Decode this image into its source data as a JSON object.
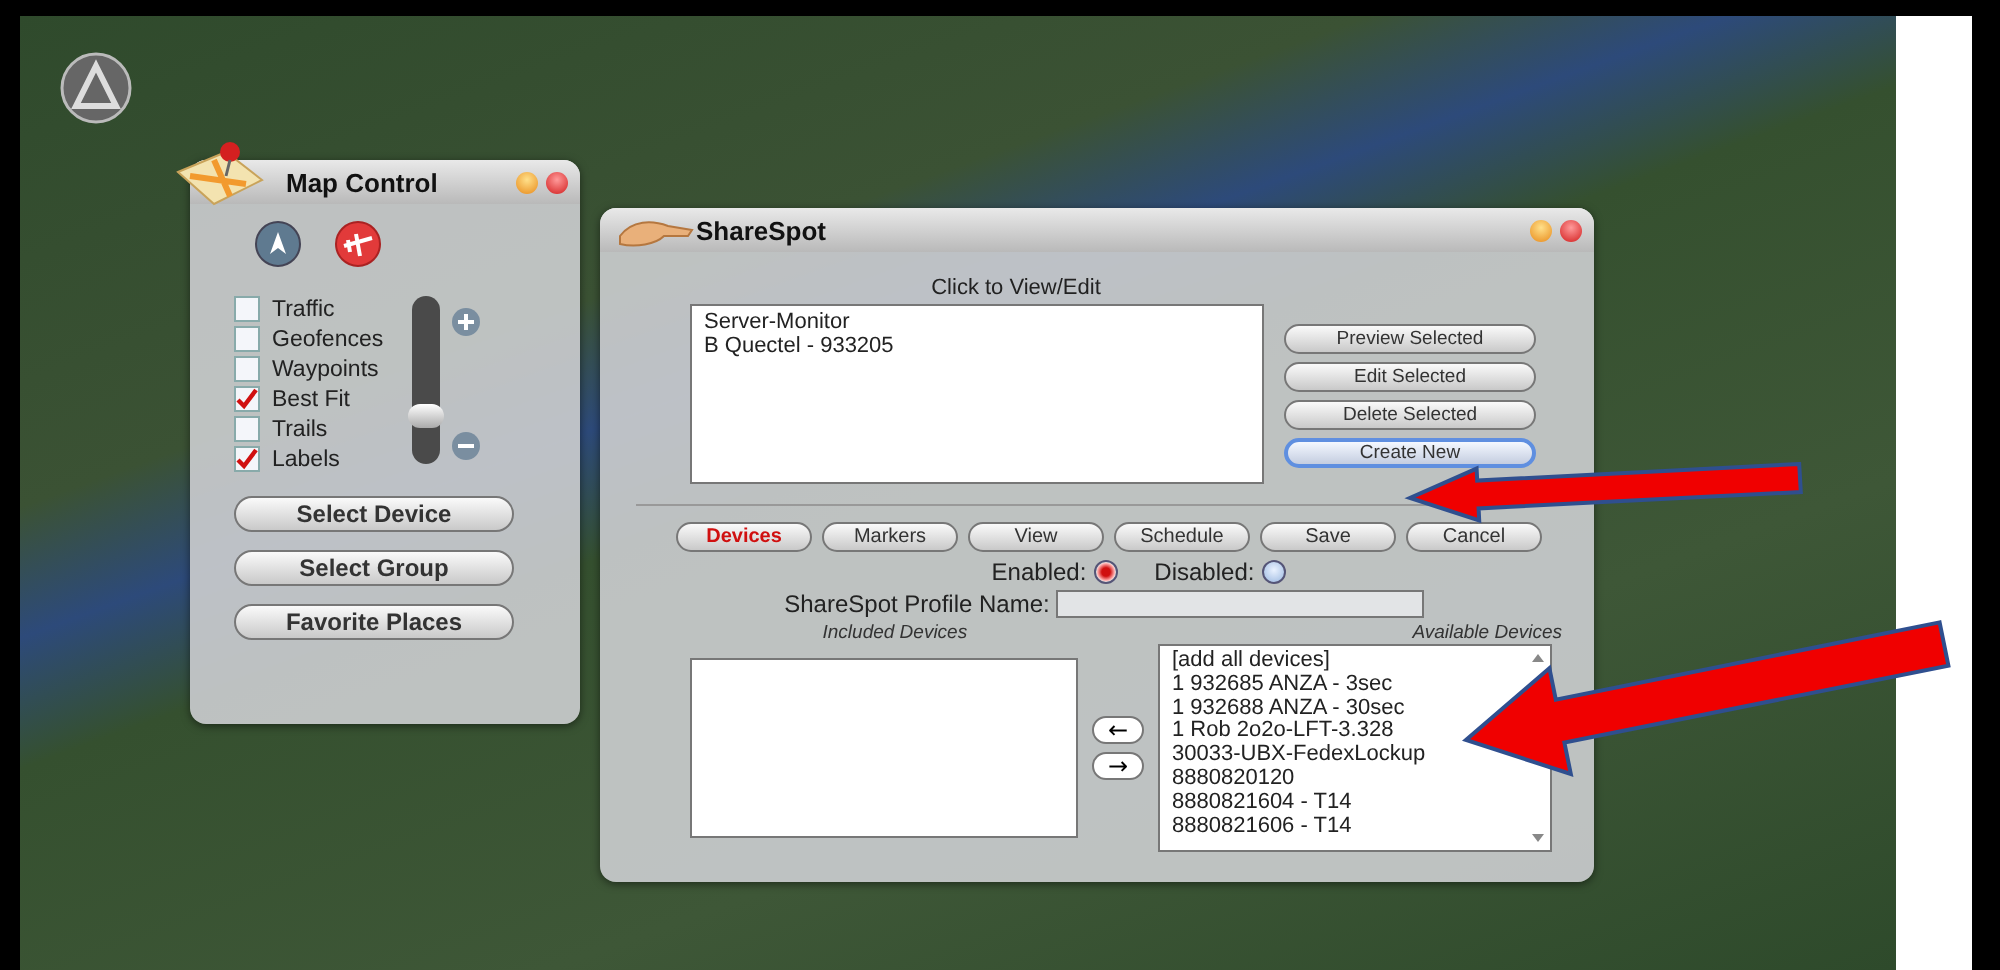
{
  "map_control": {
    "title": "Map Control",
    "layers": [
      {
        "label": "Traffic",
        "checked": false
      },
      {
        "label": "Geofences",
        "checked": false
      },
      {
        "label": "Waypoints",
        "checked": false
      },
      {
        "label": "Best Fit",
        "checked": true
      },
      {
        "label": "Trails",
        "checked": false
      },
      {
        "label": "Labels",
        "checked": true
      }
    ],
    "zoom_slider": {
      "level": 0.25
    },
    "buttons": [
      "Select Device",
      "Select Group",
      "Favorite Places"
    ]
  },
  "sharespot": {
    "title": "ShareSpot",
    "list_heading": "Click to View/Edit",
    "profiles": [
      "Server-Monitor",
      "B Quectel - 933205"
    ],
    "actions": [
      {
        "label": "Preview Selected",
        "focused": false
      },
      {
        "label": "Edit Selected",
        "focused": false
      },
      {
        "label": "Delete Selected",
        "focused": false
      },
      {
        "label": "Create New",
        "focused": true
      }
    ],
    "tabs": [
      {
        "label": "Devices",
        "selected": true
      },
      {
        "label": "Markers",
        "selected": false
      },
      {
        "label": "View",
        "selected": false
      },
      {
        "label": "Schedule",
        "selected": false
      },
      {
        "label": "Save",
        "selected": false
      },
      {
        "label": "Cancel",
        "selected": false
      }
    ],
    "status": [
      {
        "label": "Enabled:",
        "selected": true
      },
      {
        "label": "Disabled:",
        "selected": false
      }
    ],
    "profile_name": {
      "label": "ShareSpot Profile Name:"
    },
    "included": {
      "heading": "Included Devices"
    },
    "move_buttons": [
      "←",
      "→"
    ],
    "available": {
      "heading": "Available Devices",
      "items": [
        "[add all devices]",
        "1 932685 ANZA - 3sec",
        "1 932688 ANZA - 30sec",
        "1 Rob 2o2o-LFT-3.328",
        "30033-UBX-FedexLockup",
        "8880820120",
        "8880821604 - T14",
        "8880821606 - T14"
      ]
    }
  },
  "annotations": [
    {
      "kind": "arrow"
    },
    {
      "kind": "arrow"
    }
  ]
}
